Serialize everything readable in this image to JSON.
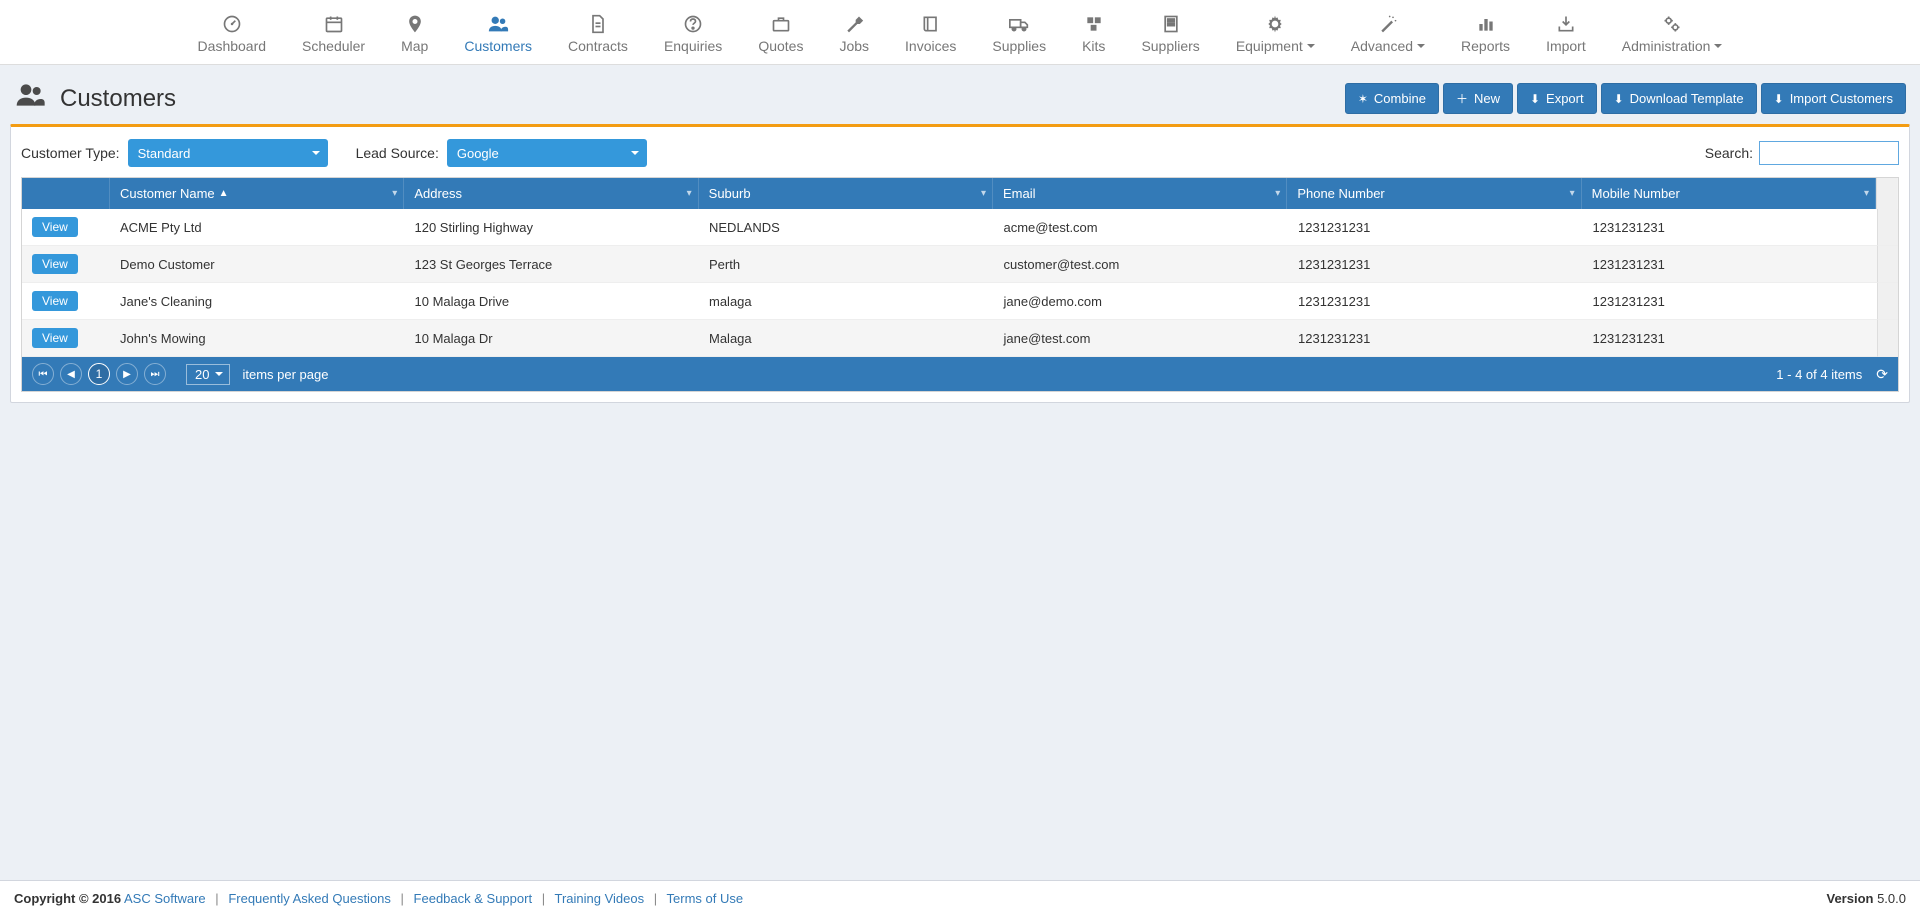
{
  "nav": {
    "items": [
      {
        "label": "Dashboard"
      },
      {
        "label": "Scheduler"
      },
      {
        "label": "Map"
      },
      {
        "label": "Customers"
      },
      {
        "label": "Contracts"
      },
      {
        "label": "Enquiries"
      },
      {
        "label": "Quotes"
      },
      {
        "label": "Jobs"
      },
      {
        "label": "Invoices"
      },
      {
        "label": "Supplies"
      },
      {
        "label": "Kits"
      },
      {
        "label": "Suppliers"
      },
      {
        "label": "Equipment"
      },
      {
        "label": "Advanced"
      },
      {
        "label": "Reports"
      },
      {
        "label": "Import"
      },
      {
        "label": "Administration"
      }
    ]
  },
  "page": {
    "title": "Customers"
  },
  "actions": {
    "combine": "Combine",
    "new": "New",
    "export": "Export",
    "download_template": "Download Template",
    "import_customers": "Import Customers"
  },
  "filters": {
    "customer_type_label": "Customer Type:",
    "customer_type_value": "Standard",
    "lead_source_label": "Lead Source:",
    "lead_source_value": "Google",
    "search_label": "Search:"
  },
  "table": {
    "view_label": "View",
    "cols": {
      "name": "Customer Name",
      "address": "Address",
      "suburb": "Suburb",
      "email": "Email",
      "phone": "Phone Number",
      "mobile": "Mobile Number"
    },
    "rows": [
      {
        "name": "ACME Pty Ltd",
        "address": "120 Stirling Highway",
        "suburb": "NEDLANDS",
        "email": "acme@test.com",
        "phone": "1231231231",
        "mobile": "1231231231"
      },
      {
        "name": "Demo Customer",
        "address": "123 St Georges Terrace",
        "suburb": "Perth",
        "email": "customer@test.com",
        "phone": "1231231231",
        "mobile": "1231231231"
      },
      {
        "name": "Jane's Cleaning",
        "address": "10 Malaga Drive",
        "suburb": "malaga",
        "email": "jane@demo.com",
        "phone": "1231231231",
        "mobile": "1231231231"
      },
      {
        "name": "John's Mowing",
        "address": "10 Malaga Dr",
        "suburb": "Malaga",
        "email": "jane@test.com",
        "phone": "1231231231",
        "mobile": "1231231231"
      }
    ]
  },
  "pager": {
    "current_page": "1",
    "page_size": "20",
    "items_per_page": "items per page",
    "summary": "1 - 4 of 4 items"
  },
  "footer": {
    "copyright_prefix": "Copyright © 2016",
    "company": "ASC Software",
    "faq": "Frequently Asked Questions",
    "feedback": "Feedback & Support",
    "training": "Training Videos",
    "terms": "Terms of Use",
    "version_label": "Version",
    "version_value": "5.0.0",
    "sep": "|"
  }
}
